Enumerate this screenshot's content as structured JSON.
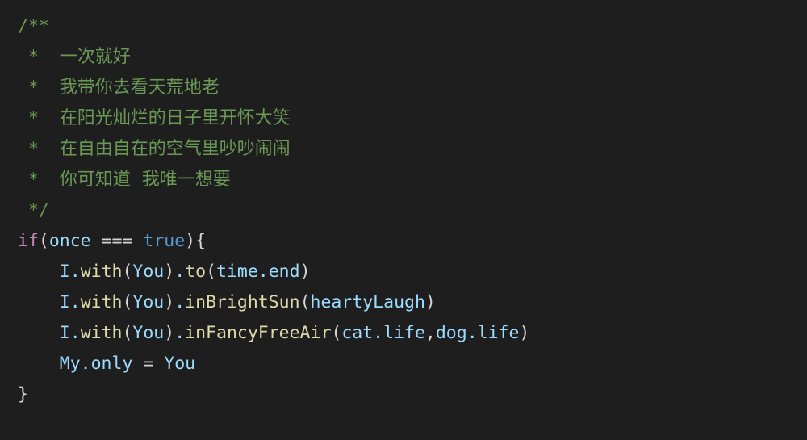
{
  "editor": {
    "theme_name": "dark",
    "background_color": "#1e1e1e",
    "language": "javascript",
    "colors": {
      "comment": "#6a9955",
      "keyword": "#c586c0",
      "boolean": "#569cd6",
      "identifier": "#9cdcfe",
      "method": "#dcdcaa",
      "punctuation": "#d4d4d4",
      "operator": "#d4d4d4"
    }
  },
  "code": {
    "lines": [
      {
        "id": "l1",
        "text": "/**"
      },
      {
        "id": "l2",
        "text": " *  一次就好"
      },
      {
        "id": "l3",
        "text": " *  我带你去看天荒地老"
      },
      {
        "id": "l4",
        "text": " *  在阳光灿烂的日子里开怀大笑"
      },
      {
        "id": "l5",
        "text": " *  在自由自在的空气里吵吵闹闹"
      },
      {
        "id": "l6",
        "text": " *  你可知道  我唯一想要"
      },
      {
        "id": "l7",
        "text": " */"
      },
      {
        "id": "l8",
        "text": "if(once === true){"
      },
      {
        "id": "l9",
        "text": "    I.with(You).to(time.end)"
      },
      {
        "id": "l10",
        "text": "    I.with(You).inBrightSun(heartyLaugh)"
      },
      {
        "id": "l11",
        "text": "    I.with(You).inFancyFreeAir(cat.life,dog.life)"
      },
      {
        "id": "l12",
        "text": "    My.only = You"
      },
      {
        "id": "l13",
        "text": "}"
      }
    ],
    "tokens": {
      "comment_open": "/**",
      "comment_star": " *",
      "comment_close": " */",
      "comment_line_1": "一次就好",
      "comment_line_2": "我带你去看天荒地老",
      "comment_line_3": "在阳光灿烂的日子里开怀大笑",
      "comment_line_4": "在自由自在的空气里吵吵闹闹",
      "comment_line_5": "你可知道  我唯一想要",
      "kw_if": "if",
      "paren_open": "(",
      "paren_close": ")",
      "brace_open": "{",
      "brace_close": "}",
      "id_once": "once",
      "op_strict_equals": "===",
      "bool_true": "true",
      "indent4": "    ",
      "id_I": "I",
      "dot": ".",
      "m_with": "with",
      "id_You": "You",
      "m_to": "to",
      "id_time_end": "time.end",
      "m_inBrightSun": "inBrightSun",
      "id_heartyLaugh": "heartyLaugh",
      "m_inFancyFreeAir": "inFancyFreeAir",
      "id_cat_life": "cat.life",
      "comma": ",",
      "id_dog_life": "dog.life",
      "id_My_only": "My.only",
      "op_assign": "=",
      "sp": " "
    }
  }
}
